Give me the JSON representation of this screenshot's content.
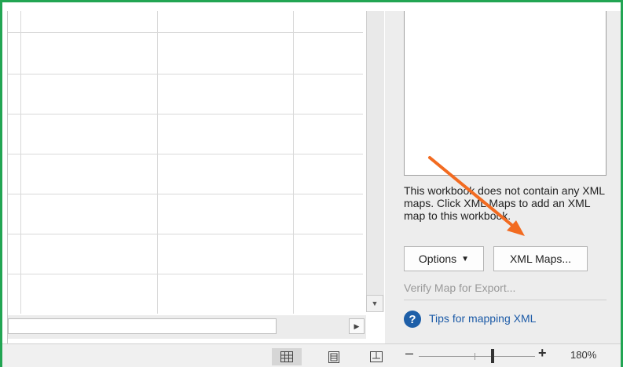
{
  "task_pane": {
    "message": "This workbook does not contain any XML maps. Click XML Maps to add an XML map to this workbook.",
    "options_label": "Options",
    "xml_maps_label": "XML Maps...",
    "verify_label": "Verify Map for Export...",
    "tips_label": "Tips for mapping XML"
  },
  "status_bar": {
    "zoom_level": "180%",
    "zoom_minus": "–",
    "zoom_plus": "+"
  },
  "colors": {
    "frame": "#22a553",
    "arrow": "#f26b21",
    "link": "#1b5aa7"
  }
}
